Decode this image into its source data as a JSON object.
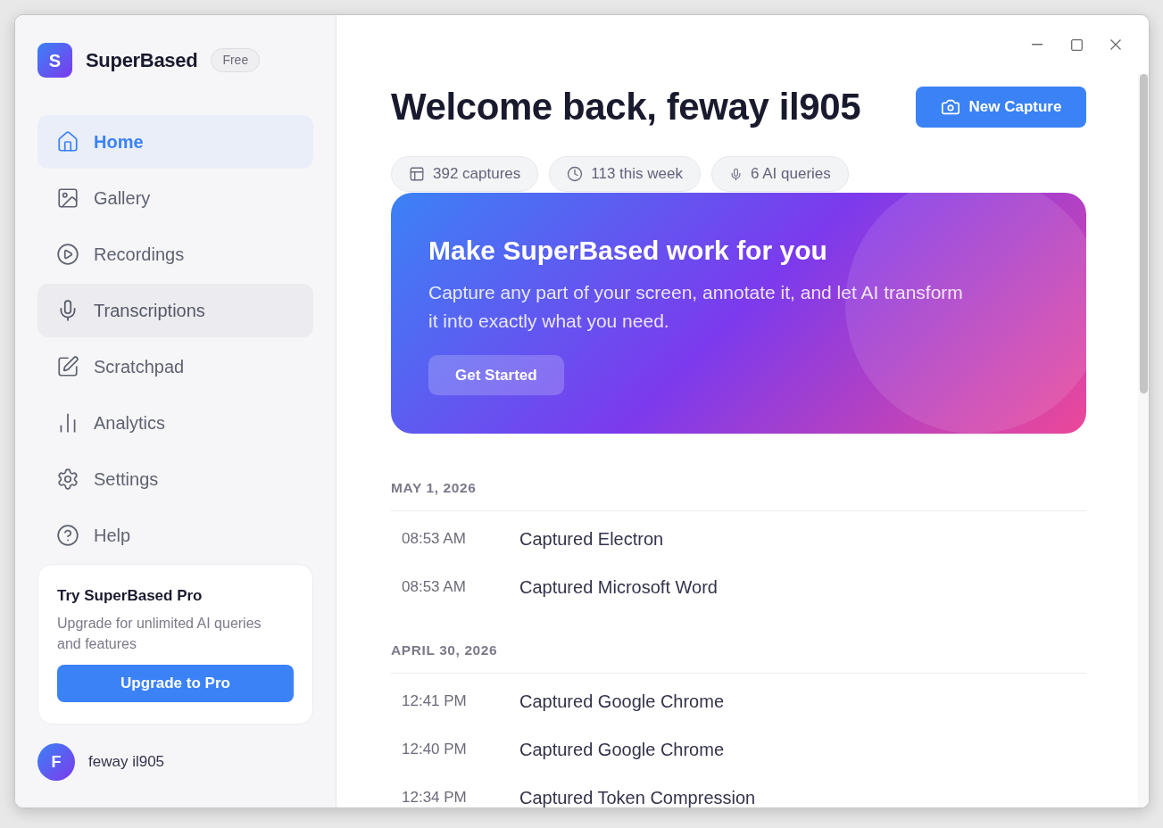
{
  "sidebar": {
    "logo_letter": "S",
    "app_name": "SuperBased",
    "plan_badge": "Free",
    "nav_items": [
      {
        "label": "Home",
        "selected": true,
        "hovered": false
      },
      {
        "label": "Gallery",
        "selected": false,
        "hovered": false
      },
      {
        "label": "Recordings",
        "selected": false,
        "hovered": false
      },
      {
        "label": "Transcriptions",
        "selected": false,
        "hovered": true
      },
      {
        "label": "Scratchpad",
        "selected": false,
        "hovered": false
      },
      {
        "label": "Analytics",
        "selected": false,
        "hovered": false
      },
      {
        "label": "Settings",
        "selected": false,
        "hovered": false
      },
      {
        "label": "Help",
        "selected": false,
        "hovered": false
      }
    ],
    "promo": {
      "title": "Try SuperBased Pro",
      "description": "Upgrade for unlimited AI queries and features",
      "button": "Upgrade to Pro"
    },
    "user": {
      "initial": "F",
      "name": "feway il905"
    }
  },
  "main": {
    "title": "Welcome back, feway il905",
    "primary_button": "New Capture",
    "stats": [
      {
        "label": "392 captures"
      },
      {
        "label": "113 this week"
      },
      {
        "label": "6 AI queries"
      }
    ],
    "banner": {
      "title": "Make SuperBased work for you",
      "description": "Capture any part of your screen, annotate it, and let AI transform it into exactly what you need.",
      "button": "Get Started"
    },
    "activity": [
      {
        "date": "MAY 1, 2026",
        "entries": [
          {
            "time": "08:53 AM",
            "text": "Captured Electron"
          },
          {
            "time": "08:53 AM",
            "text": "Captured Microsoft Word"
          }
        ]
      },
      {
        "date": "APRIL 30, 2026",
        "entries": [
          {
            "time": "12:41 PM",
            "text": "Captured Google Chrome"
          },
          {
            "time": "12:40 PM",
            "text": "Captured Google Chrome"
          },
          {
            "time": "12:34 PM",
            "text": "Captured Token Compression"
          }
        ]
      }
    ]
  }
}
